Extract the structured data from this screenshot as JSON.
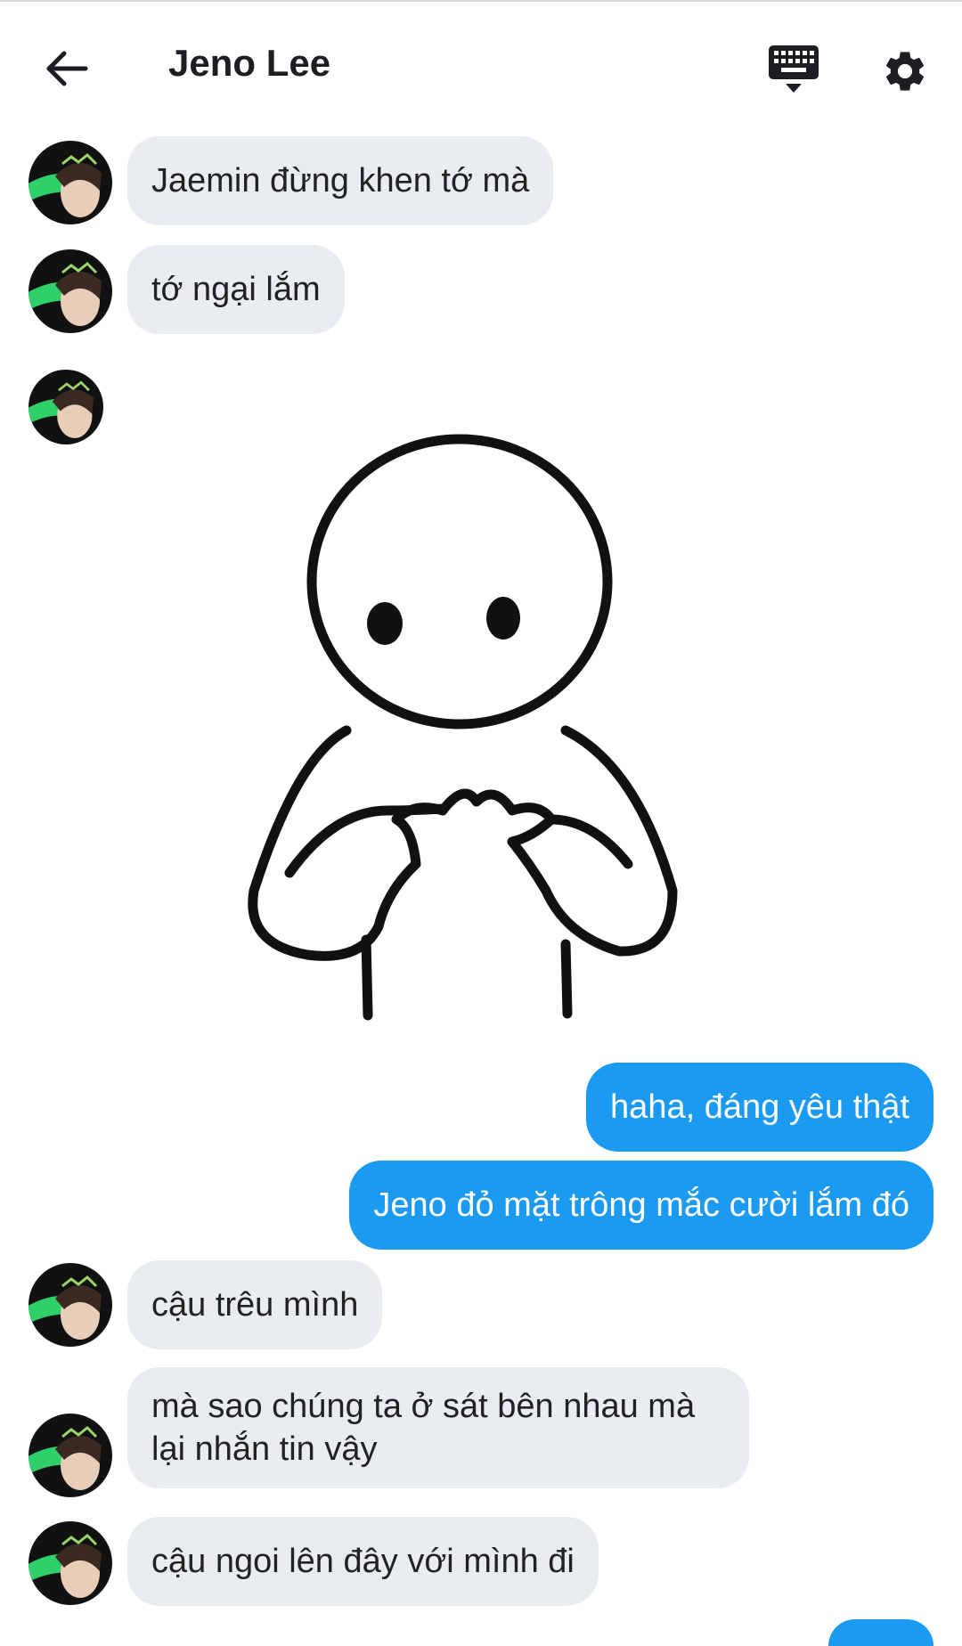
{
  "header": {
    "title": "Jeno Lee",
    "back_icon": "arrow-left-icon",
    "keyboard_icon": "keyboard-icon",
    "settings_icon": "gear-icon"
  },
  "colors": {
    "incoming_bubble": "#e9ecf0",
    "outgoing_bubble": "#1b9af2",
    "avatar_accent": "#2fd06a"
  },
  "messages": [
    {
      "from": "Jeno Lee",
      "direction": "incoming",
      "text": "Jaemin đừng khen tớ mà"
    },
    {
      "from": "Jeno Lee",
      "direction": "incoming",
      "text": "tớ ngại lắm"
    },
    {
      "from": "Jeno Lee",
      "direction": "incoming",
      "type": "sticker",
      "sticker": "shy-stick-figure-sticker"
    },
    {
      "direction": "outgoing",
      "text": "haha, đáng yêu thật"
    },
    {
      "direction": "outgoing",
      "text": "Jeno đỏ mặt trông mắc cười lắm đó"
    },
    {
      "from": "Jeno Lee",
      "direction": "incoming",
      "text": "cậu trêu mình"
    },
    {
      "from": "Jeno Lee",
      "direction": "incoming",
      "text": "mà sao chúng ta ở sát bên nhau mà lại nhắn tin vậy"
    },
    {
      "from": "Jeno Lee",
      "direction": "incoming",
      "text": "cậu ngoi lên đây với mình đi"
    }
  ]
}
